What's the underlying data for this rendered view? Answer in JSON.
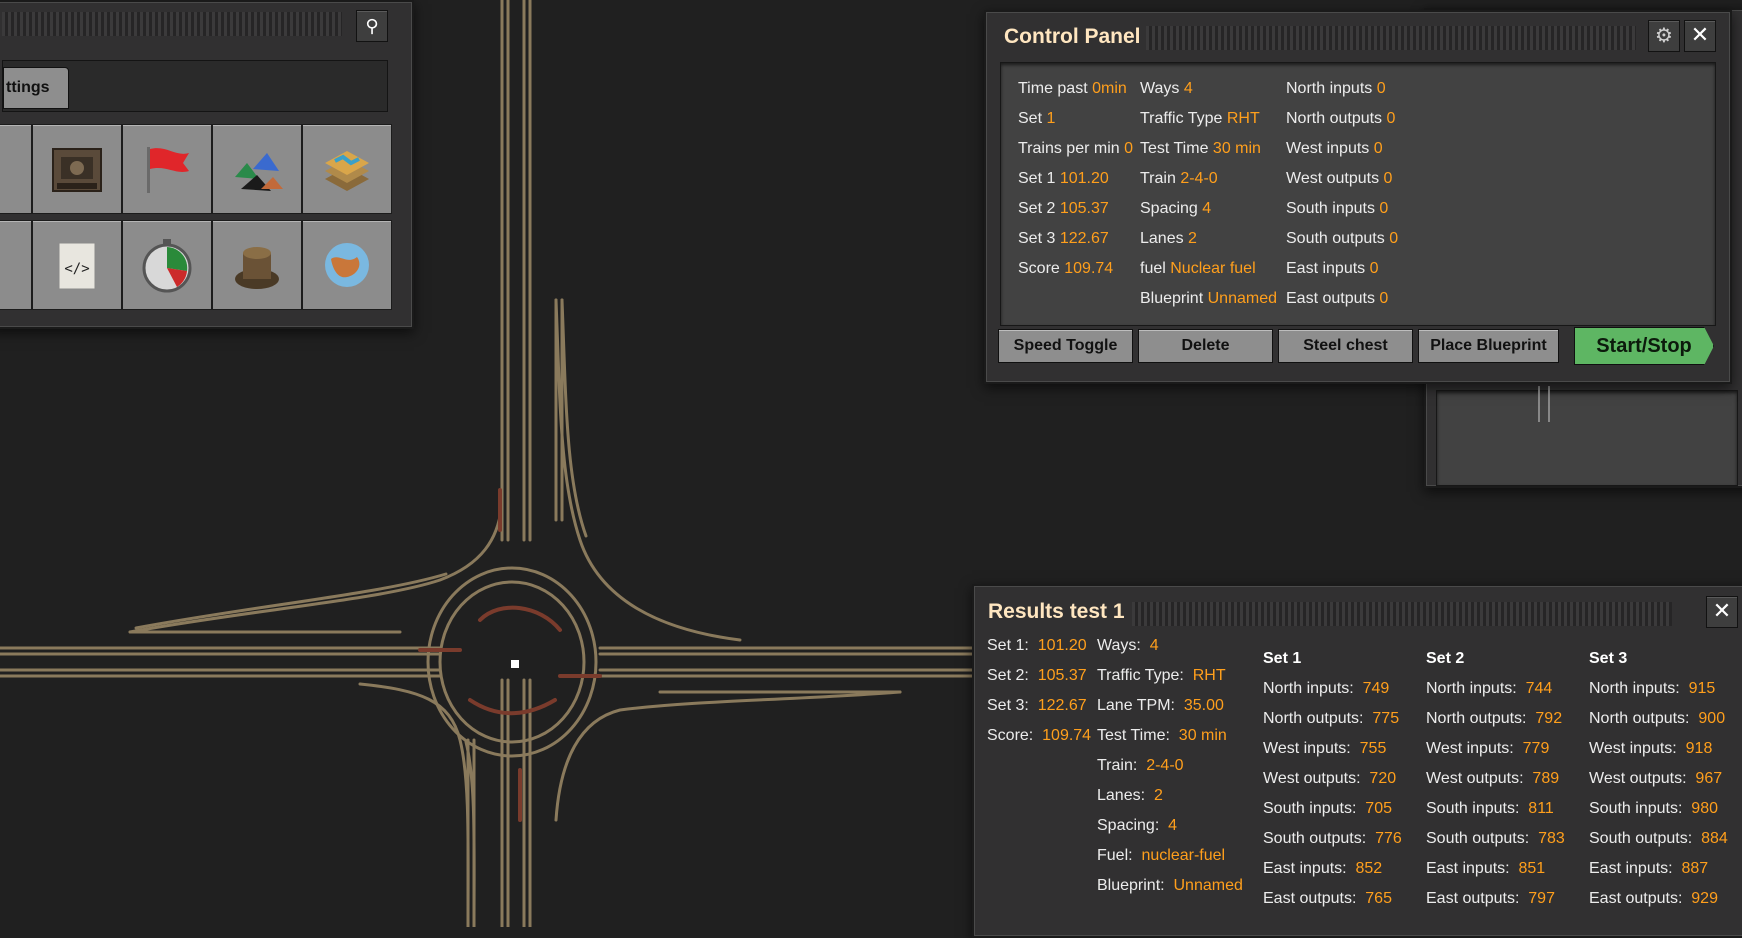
{
  "toolbar_panel": {
    "tab_label": "ttings"
  },
  "control_panel": {
    "title": "Control Panel",
    "col1": [
      {
        "label": "Time past",
        "value": "0min"
      },
      {
        "label": "Set",
        "value": "1"
      },
      {
        "label": "Trains per min",
        "value": "0"
      },
      {
        "label": "Set 1",
        "value": "101.20"
      },
      {
        "label": "Set 2",
        "value": "105.37"
      },
      {
        "label": "Set 3",
        "value": "122.67"
      },
      {
        "label": "Score",
        "value": "109.74"
      }
    ],
    "col2": [
      {
        "label": "Ways",
        "value": "4"
      },
      {
        "label": "Traffic Type",
        "value": "RHT"
      },
      {
        "label": "Test Time",
        "value": "30 min"
      },
      {
        "label": "Train",
        "value": "2-4-0"
      },
      {
        "label": "Spacing",
        "value": "4"
      },
      {
        "label": "Lanes",
        "value": "2"
      },
      {
        "label": "fuel",
        "value": "Nuclear fuel"
      },
      {
        "label": "Blueprint",
        "value": "Unnamed"
      }
    ],
    "col3": [
      {
        "label": "North inputs",
        "value": "0"
      },
      {
        "label": "North outputs",
        "value": "0"
      },
      {
        "label": "West inputs",
        "value": "0"
      },
      {
        "label": "West outputs",
        "value": "0"
      },
      {
        "label": "South inputs",
        "value": "0"
      },
      {
        "label": "South outputs",
        "value": "0"
      },
      {
        "label": "East inputs",
        "value": "0"
      },
      {
        "label": "East outputs",
        "value": "0"
      }
    ],
    "buttons": {
      "speed_toggle": "Speed Toggle",
      "delete": "Delete",
      "steel_chest": "Steel chest",
      "place_blueprint": "Place Blueprint",
      "start_stop": "Start/Stop"
    }
  },
  "results": {
    "title": "Results test 1",
    "summary": [
      {
        "label": "Set 1:",
        "value": "101.20"
      },
      {
        "label": "Set 2:",
        "value": "105.37"
      },
      {
        "label": "Set 3:",
        "value": "122.67"
      },
      {
        "label": "Score:",
        "value": "109.74"
      }
    ],
    "params": [
      {
        "label": "Ways:",
        "value": "4"
      },
      {
        "label": "Traffic Type:",
        "value": "RHT"
      },
      {
        "label": "Lane TPM:",
        "value": "35.00"
      },
      {
        "label": "Test Time:",
        "value": "30 min"
      },
      {
        "label": "Train:",
        "value": "2-4-0"
      },
      {
        "label": "Lanes:",
        "value": "2"
      },
      {
        "label": "Spacing:",
        "value": "4"
      },
      {
        "label": "Fuel:",
        "value": "nuclear-fuel"
      },
      {
        "label": "Blueprint:",
        "value": "Unnamed"
      }
    ],
    "sets": [
      {
        "name": "Set 1",
        "rows": [
          {
            "label": "North inputs:",
            "value": "749"
          },
          {
            "label": "North outputs:",
            "value": "775"
          },
          {
            "label": "West inputs:",
            "value": "755"
          },
          {
            "label": "West outputs:",
            "value": "720"
          },
          {
            "label": "South inputs:",
            "value": "705"
          },
          {
            "label": "South outputs:",
            "value": "776"
          },
          {
            "label": "East inputs:",
            "value": "852"
          },
          {
            "label": "East outputs:",
            "value": "765"
          }
        ]
      },
      {
        "name": "Set 2",
        "rows": [
          {
            "label": "North inputs:",
            "value": "744"
          },
          {
            "label": "North outputs:",
            "value": "792"
          },
          {
            "label": "West inputs:",
            "value": "779"
          },
          {
            "label": "West outputs:",
            "value": "789"
          },
          {
            "label": "South inputs:",
            "value": "811"
          },
          {
            "label": "South outputs:",
            "value": "783"
          },
          {
            "label": "East inputs:",
            "value": "851"
          },
          {
            "label": "East outputs:",
            "value": "797"
          }
        ]
      },
      {
        "name": "Set 3",
        "rows": [
          {
            "label": "North inputs:",
            "value": "915"
          },
          {
            "label": "North outputs:",
            "value": "900"
          },
          {
            "label": "West inputs:",
            "value": "918"
          },
          {
            "label": "West outputs:",
            "value": "967"
          },
          {
            "label": "South inputs:",
            "value": "980"
          },
          {
            "label": "South outputs:",
            "value": "884"
          },
          {
            "label": "East inputs:",
            "value": "887"
          },
          {
            "label": "East outputs:",
            "value": "929"
          }
        ]
      }
    ]
  },
  "colors": {
    "value": "#ff9f1c",
    "rail": "#8a7a5c",
    "start_button": "#5eb663"
  },
  "icons": [
    "search-icon",
    "gear-icon",
    "close-icon"
  ]
}
